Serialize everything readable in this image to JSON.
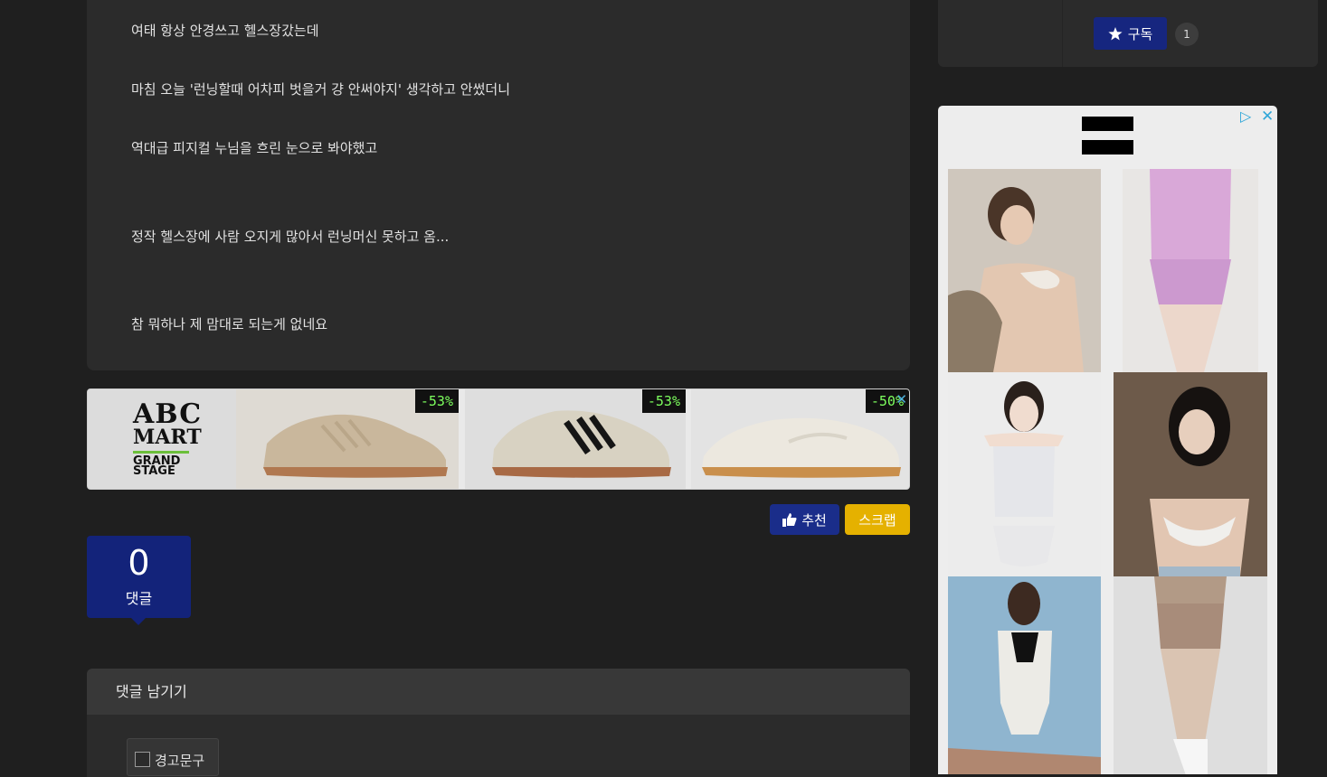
{
  "post": {
    "lines": [
      "여태 항상 안경쓰고 헬스장갔는데",
      "마침 오늘 '런닝할때 어차피 벗을거 걍 안써야지' 생각하고 안썼더니",
      "역대급 피지컬 누님을 흐린 눈으로 봐야했고",
      "정작 헬스장에 사람 오지게 많아서 런닝머신 못하고 옴...",
      "참 뭐하나 제 맘대로 되는게 없네요"
    ]
  },
  "ad_banner": {
    "brand_line1": "ABC",
    "brand_line2": "MART",
    "brand_sub": "GRAND\nSTAGE",
    "products": [
      {
        "discount": "-53%",
        "icon": "sneaker-tan-suede-icon"
      },
      {
        "discount": "-53%",
        "icon": "sneaker-stripes-icon"
      },
      {
        "discount": "-50%",
        "icon": "sneaker-white-icon"
      }
    ],
    "close": "✕"
  },
  "actions": {
    "recommend_label": "추천",
    "scrap_label": "스크랩"
  },
  "comments": {
    "count": "0",
    "count_label": "댓글",
    "leave_comment": "댓글 남기기",
    "warning_label": "경고문구"
  },
  "sidebar": {
    "subscribe_label": "구독",
    "subscribe_count": "1",
    "ad_choices": "▷",
    "ad_close": "✕"
  },
  "colors": {
    "page_bg": "#1f1f1f",
    "card_bg": "#2b2b2b",
    "primary": "#1a2d8a",
    "scrap": "#e5b100",
    "discount_text": "#7dff5e"
  }
}
